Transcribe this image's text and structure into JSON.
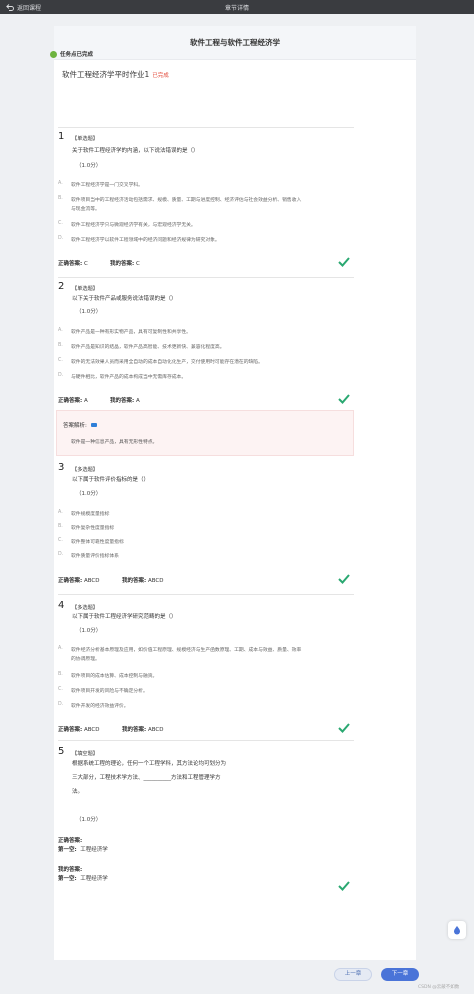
{
  "topbar": {
    "back_label": "返回课程",
    "title": "章节详情"
  },
  "panel": {
    "title": "软件工程与软件工程经济学"
  },
  "status": {
    "label": "任务点已完成"
  },
  "homework": {
    "title": "软件工程经济学平时作业1",
    "state": "已完成"
  },
  "questions": [
    {
      "number": "1",
      "type": "【单选题】",
      "stem": "关于软件工程经济学的内涵，以下说法错误的是（）",
      "score": "（1.0分）",
      "options": [
        {
          "letter": "A.",
          "text": "软件工程经济学是一门交叉学科。"
        },
        {
          "letter": "B.",
          "text": "软件项目当中的工程经济活动包括需求、规模、质量、工期与进度控制、经济评估与社会效益分析、销售收入与现金流等。"
        },
        {
          "letter": "C.",
          "text": "软件工程经济学只与微观经济学有关，与宏观经济学无关。"
        },
        {
          "letter": "D.",
          "text": "软件工程经济学以软件工程领域中的经济问题和经济规律为研究对象。"
        }
      ],
      "correct_label": "正确答案:",
      "correct": "C",
      "mine_label": "我的答案:",
      "mine": "C"
    },
    {
      "number": "2",
      "type": "【单选题】",
      "stem": "以下关于软件产品或服务说法错误的是（）",
      "score": "（1.0分）",
      "options": [
        {
          "letter": "A.",
          "text": "软件产品是一种有形实物产品，具有可复制性和共享性。"
        },
        {
          "letter": "B.",
          "text": "软件产品是知识的结晶，软件产品高智能、技术更新快、兼容化程度高。"
        },
        {
          "letter": "C.",
          "text": "软件的无法效果人员而采用全自动的成本自动化化生产，交付使用时可能存在潜在的缺陷。"
        },
        {
          "letter": "D.",
          "text": "与硬件相比，软件产品的成本构成当中无需库存成本。"
        }
      ],
      "correct_label": "正确答案:",
      "correct": "A",
      "mine_label": "我的答案:",
      "mine": "A",
      "analysis_label": "答案解析:",
      "analysis_text": "软件是一种信息产品，具有无形性特点。"
    },
    {
      "number": "3",
      "type": "【多选题】",
      "stem": "以下属于软件评价指标的是（）",
      "score": "（1.0分）",
      "options": [
        {
          "letter": "A.",
          "text": "软件规模度量指标"
        },
        {
          "letter": "B.",
          "text": "软件复杂性度量指标"
        },
        {
          "letter": "C.",
          "text": "软件整体可靠性度量指标"
        },
        {
          "letter": "D.",
          "text": "软件质量评价指标体系"
        }
      ],
      "correct_label": "正确答案:",
      "correct": "ABCD",
      "mine_label": "我的答案:",
      "mine": "ABCD"
    },
    {
      "number": "4",
      "type": "【多选题】",
      "stem": "以下属于软件工程经济学研究范畴的是（）",
      "score": "（1.0分）",
      "options": [
        {
          "letter": "A.",
          "text": "软件经济分析基本原理及应用，如价值工程原理、规模经济与生产函数原理、工期、成本与效益、质量、效率的协调原理。"
        },
        {
          "letter": "B.",
          "text": "软件项目的成本估算、成本控制与融资。"
        },
        {
          "letter": "C.",
          "text": "软件项目开发的风险与不确定分析。"
        },
        {
          "letter": "D.",
          "text": "软件开发的经济效益评价。"
        }
      ],
      "correct_label": "正确答案:",
      "correct": "ABCD",
      "mine_label": "我的答案:",
      "mine": "ABCD"
    },
    {
      "number": "5",
      "type": "【填空题】",
      "stem_lines": [
        "根据系统工程的理论，任何一个工程学科，其方法论均可划分为",
        "三大部分，工程技术学方法、__________方法和工程管理学方",
        "法。"
      ],
      "score": "（1.0分）",
      "correct_label": "正确答案:",
      "correct_blank_label": "第一空:",
      "correct_blank": "工程经济学",
      "mine_label": "我的答案:",
      "mine_blank_label": "第一空:",
      "mine_blank": "工程经济学"
    }
  ],
  "nav": {
    "prev": "上一章",
    "next": "下一章"
  },
  "watermark": "CSDN @云蔽不如数",
  "colors": {
    "accent": "#4a74d8",
    "check": "#2aa871",
    "done": "#e24b3b",
    "status_dot": "#6db33f"
  }
}
